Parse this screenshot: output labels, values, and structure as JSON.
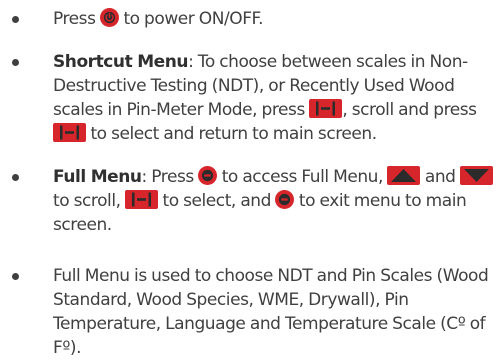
{
  "colors": {
    "text": "#404040",
    "icon_red": "#d6262c",
    "icon_dark": "#2b2b2b"
  },
  "icons": {
    "power": "power-button-icon",
    "menu": "menu-button-icon",
    "select": "select-button-icon",
    "up": "up-arrow-button-icon",
    "down": "down-arrow-button-icon"
  },
  "items": [
    {
      "t1": "Press",
      "t2": "to power ON/OFF."
    },
    {
      "title": "Shortcut Menu",
      "t1": ": To choose between scales in Non-Destructive Testing (NDT), or Recently Used Wood scales in Pin-Meter Mode, press",
      "t2": ", scroll and press",
      "t3": "to select and return to main screen."
    },
    {
      "title": "Full Menu",
      "t1": ": Press",
      "t2": "to access Full Menu,",
      "t3": "and",
      "t4": "to scroll,",
      "t5": "to select, and",
      "t6": "to exit menu to main screen."
    },
    {
      "t1": "Full Menu is used to choose NDT and Pin Scales (Wood Standard, Wood Species, WME, Drywall), Pin Temperature, Language and Temperature Scale (Cº of Fº)."
    }
  ]
}
